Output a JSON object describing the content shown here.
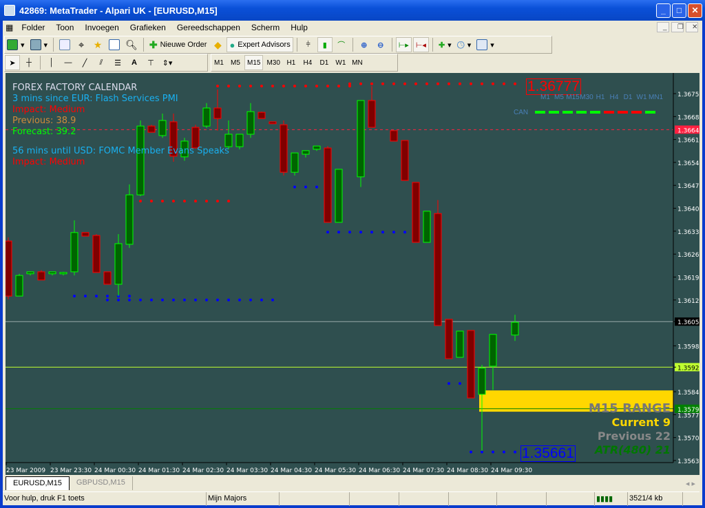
{
  "window": {
    "title": "42869: MetaTrader - Alpari UK - [EURUSD,M15]"
  },
  "menu": [
    "Folder",
    "Toon",
    "Invoegen",
    "Grafieken",
    "Gereedschappen",
    "Scherm",
    "Hulp"
  ],
  "toolbar": {
    "new_order": "Nieuwe Order",
    "expert_advisors": "Expert Advisors"
  },
  "draw_tools": {
    "text_tool": "A"
  },
  "periods": [
    "M1",
    "M5",
    "M15",
    "M30",
    "H1",
    "H4",
    "D1",
    "W1",
    "MN"
  ],
  "active_period": "M15",
  "calendar": {
    "title": "FOREX FACTORY CALENDAR",
    "event1": "3 mins since EUR: Flash Services PMI",
    "impact1": "Impact: Medium",
    "previous": "Previous: 38.9",
    "forecast": "Forecast: 39.2",
    "event2": "56 mins until USD: FOMC Member Evans Speaks",
    "impact2": "Impact: Medium"
  },
  "trend_panel": {
    "label": "CAN",
    "timeframes": [
      "M1",
      "M5",
      "M15",
      "M30",
      "H1",
      "H4",
      "D1",
      "W1",
      "MN1"
    ],
    "states": [
      "up",
      "up",
      "up",
      "up",
      "up",
      "down",
      "down",
      "down",
      "up"
    ],
    "up_color": "#00ff00",
    "down_color": "#ff0000"
  },
  "range_panel": {
    "title": "M15 RANGE",
    "current": "Current 9",
    "previous": "Previous 22",
    "atr": "ATR(480) 21"
  },
  "high_label": "1.36777",
  "low_label": "1.35661",
  "tabs": [
    "EURUSD,M15",
    "GBPUSD,M15"
  ],
  "status": {
    "help": "Voor hulp, druk F1 toets",
    "profile": "Mijn Majors",
    "traffic": "3521/4 kb"
  },
  "chart_data": {
    "type": "candlestick",
    "symbol": "EURUSD",
    "timeframe": "M15",
    "y_ticks": [
      "1.36755",
      "1.36685",
      "1.36615",
      "1.36545",
      "1.36475",
      "1.36405",
      "1.36335",
      "1.36265",
      "1.36195",
      "1.36125",
      "1.36059",
      "1.35985",
      "1.35920",
      "1.35845",
      "1.35775",
      "1.35705",
      "1.35635"
    ],
    "ylim": [
      1.3562,
      1.3682
    ],
    "x_ticks": [
      "23 Mar 2009",
      "23 Mar 23:30",
      "24 Mar 00:30",
      "24 Mar 01:30",
      "24 Mar 02:30",
      "24 Mar 03:30",
      "24 Mar 04:30",
      "24 Mar 05:30",
      "24 Mar 06:30",
      "24 Mar 07:30",
      "24 Mar 08:30",
      "24 Mar 09:30"
    ],
    "hlines": [
      {
        "price": 1.36645,
        "label": "1.36645",
        "color": "#ff2040",
        "style": "dashed"
      },
      {
        "price": 1.36059,
        "label": "1.36059",
        "color": "#9aa",
        "style": "solid"
      },
      {
        "price": 1.3592,
        "label": "1.35920",
        "color": "#c0ff30",
        "style": "solid"
      },
      {
        "price": 1.35793,
        "label": "1.35793",
        "color": "#008000",
        "style": "solid"
      }
    ],
    "range_band": [
      1.35784,
      1.35849
    ],
    "candles": [
      [
        1.36305,
        1.36316,
        1.36127,
        1.36137
      ],
      [
        1.36137,
        1.36205,
        1.36137,
        1.362
      ],
      [
        1.36205,
        1.36211,
        1.362,
        1.36211
      ],
      [
        1.36211,
        1.36216,
        1.36186,
        1.36186
      ],
      [
        1.36205,
        1.36211,
        1.362,
        1.36211
      ],
      [
        1.36205,
        1.36211,
        1.362,
        1.36209
      ],
      [
        1.36211,
        1.36368,
        1.362,
        1.36331
      ],
      [
        1.36331,
        1.36331,
        1.3632,
        1.3632
      ],
      [
        1.36322,
        1.36326,
        1.36209,
        1.36209
      ],
      [
        1.36211,
        1.36211,
        1.36173,
        1.36173
      ],
      [
        1.36173,
        1.36326,
        1.36137,
        1.36297
      ],
      [
        1.36295,
        1.36478,
        1.36284,
        1.36446
      ],
      [
        1.36446,
        1.36673,
        1.36442,
        1.36656
      ],
      [
        1.36656,
        1.3666,
        1.36637,
        1.36637
      ],
      [
        1.36627,
        1.36694,
        1.3662,
        1.36673
      ],
      [
        1.36669,
        1.36694,
        1.36547,
        1.36564
      ],
      [
        1.36562,
        1.3662,
        1.3655,
        1.3661
      ],
      [
        1.36652,
        1.3666,
        1.36589,
        1.36589
      ],
      [
        1.36656,
        1.36726,
        1.3665,
        1.36711
      ],
      [
        1.36711,
        1.36768,
        1.36642,
        1.36679
      ],
      [
        1.36593,
        1.36673,
        1.36585,
        1.36631
      ],
      [
        1.36593,
        1.36631,
        1.36585,
        1.36631
      ],
      [
        1.36631,
        1.36726,
        1.3662,
        1.367
      ],
      [
        1.36698,
        1.367,
        1.36679,
        1.36679
      ],
      [
        1.36669,
        1.36669,
        1.36663,
        1.36663
      ],
      [
        1.3666,
        1.36673,
        1.36505,
        1.36515
      ],
      [
        1.36515,
        1.36574,
        1.36505,
        1.36574
      ],
      [
        1.3657,
        1.36581,
        1.3656,
        1.36581
      ],
      [
        1.36585,
        1.36595,
        1.3658,
        1.36595
      ],
      [
        1.36589,
        1.36595,
        1.36362,
        1.36362
      ],
      [
        1.36362,
        1.36524,
        1.36362,
        1.36524
      ],
      [
        1.36501,
        1.3669,
        1.3647,
        1.36734
      ],
      [
        1.36734,
        1.36778,
        1.36652,
        1.36652
      ],
      [
        1.36642,
        1.36642,
        1.3661,
        1.3661
      ],
      [
        1.36612,
        1.36612,
        1.3649,
        1.3649
      ],
      [
        1.36484,
        1.36484,
        1.36301,
        1.36301
      ],
      [
        1.36301,
        1.36396,
        1.36301,
        1.36396
      ],
      [
        1.36389,
        1.3643,
        1.36047,
        1.36047
      ],
      [
        1.36066,
        1.36066,
        1.35946,
        1.35946
      ],
      [
        1.3595,
        1.3603,
        1.3595,
        1.3603
      ],
      [
        1.36032,
        1.36032,
        1.35826,
        1.35826
      ],
      [
        1.35837,
        1.35927,
        1.35665,
        1.35917
      ],
      [
        1.35923,
        1.3602,
        1.3585,
        1.3602
      ],
      [
        1.36018,
        1.3608,
        1.36,
        1.36057
      ]
    ],
    "candle_slots": [
      0,
      1,
      2,
      3,
      4,
      5,
      6,
      7,
      8,
      9,
      10,
      11,
      12,
      13,
      14,
      15,
      16,
      17,
      18,
      19,
      20,
      21,
      22,
      23,
      24,
      25,
      26,
      27,
      28,
      29,
      30,
      32,
      33,
      35,
      36,
      37,
      38,
      39,
      40,
      41,
      42,
      43,
      44,
      46
    ]
  }
}
